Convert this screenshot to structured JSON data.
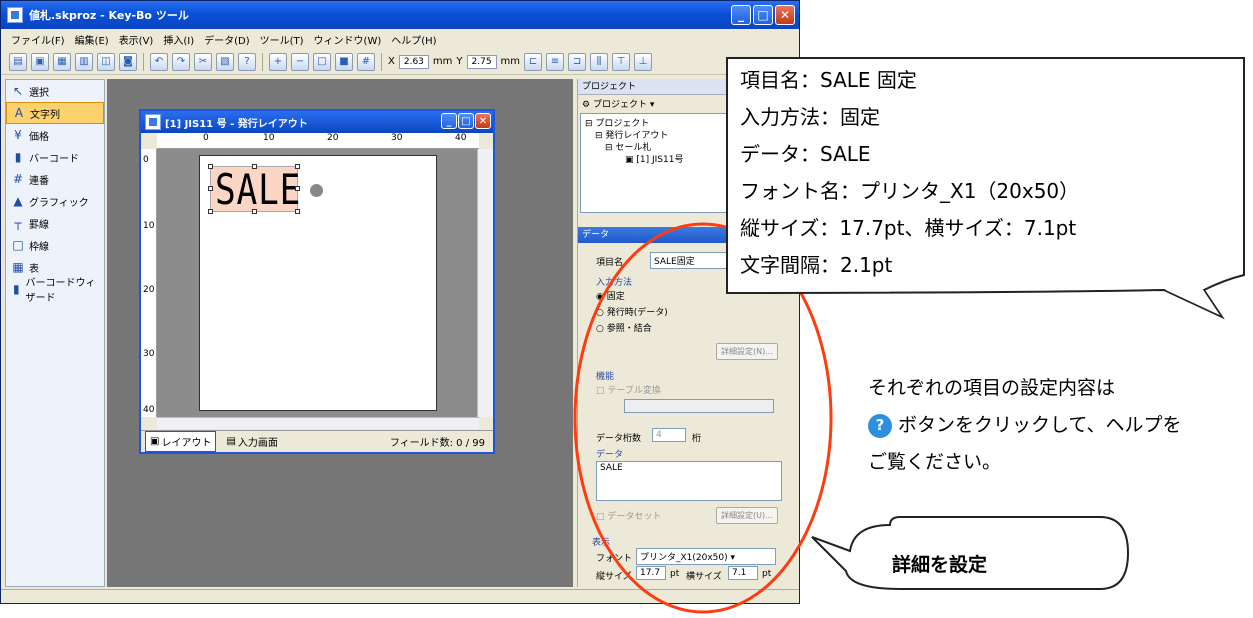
{
  "window": {
    "title": "値札.skproz - Key-Bo ツール"
  },
  "menu": [
    "ファイル(F)",
    "編集(E)",
    "表示(V)",
    "挿入(I)",
    "データ(D)",
    "ツール(T)",
    "ウィンドウ(W)",
    "ヘルプ(H)"
  ],
  "toolbar": {
    "x_label": "X",
    "x_value": "2.63",
    "x_unit": "mm",
    "y_label": "Y",
    "y_value": "2.75",
    "y_unit": "mm"
  },
  "tools": [
    {
      "label": "選択",
      "icon": "select-arrow-icon"
    },
    {
      "label": "文字列",
      "icon": "text-icon"
    },
    {
      "label": "価格",
      "icon": "price-icon"
    },
    {
      "label": "バーコード",
      "icon": "barcode-icon"
    },
    {
      "label": "連番",
      "icon": "serial-icon"
    },
    {
      "label": "グラフィック",
      "icon": "graphic-icon"
    },
    {
      "label": "罫線",
      "icon": "line-icon"
    },
    {
      "label": "枠線",
      "icon": "frame-icon"
    },
    {
      "label": "表",
      "icon": "table-icon"
    },
    {
      "label": "バーコードウィザード",
      "icon": "barcode-wizard-icon"
    }
  ],
  "document": {
    "title": "[1] JIS11 号 - 発行レイアウト",
    "ruler_top": [
      "0",
      "10",
      "20",
      "30",
      "40"
    ],
    "ruler_left": [
      "0",
      "10",
      "20",
      "30",
      "40"
    ],
    "object_text": "SALE",
    "tab_layout": "レイアウト",
    "tab_input": "入力画面",
    "field_count": "フィールド数: 0 / 99"
  },
  "project": {
    "header": "プロジェクト",
    "dropdown": "プロジェクト",
    "tree": [
      "プロジェクト",
      "発行レイアウト",
      "セール札",
      "[1] JIS11号"
    ],
    "layout_tab_partial": "レイ"
  },
  "data_panel": {
    "header": "データ",
    "item_name_label": "項目名",
    "item_name_value": "SALE固定",
    "input_method_label": "入力方法",
    "radio_fixed": "固定",
    "radio_issue": "発行時(データ)",
    "radio_ref": "参照・結合",
    "detail_btn": "詳細設定(N)...",
    "function_label": "機能",
    "table_convert": "テーブル変換",
    "digits_label": "データ桁数",
    "digits_value": "4",
    "digits_unit": "桁",
    "data_label": "データ",
    "data_value": "SALE",
    "dataset_label": "データセット",
    "detail_btn2": "詳細設定(U)...",
    "display_label": "表示",
    "font_label": "フォント",
    "font_value": "プリンタ_X1(20x50)",
    "vsize_label": "縦サイズ",
    "vsize_value": "17.7",
    "pt1": "pt",
    "hsize_label": "横サイズ",
    "hsize_value": "7.1",
    "pt2": "pt"
  },
  "callout": {
    "lines": [
      "項目名：SALE 固定",
      "入力方法：固定",
      "データ：SALE",
      "フォント名：プリンタ_X1（20x50）",
      "縦サイズ：17.7pt、横サイズ：7.1pt",
      "文字間隔：2.1pt"
    ]
  },
  "note": {
    "line1": "それぞれの項目の設定内容は",
    "line2": "ボタンをクリックして、ヘルプを",
    "line3": "ご覧ください。"
  },
  "bubble": {
    "text": "詳細を設定"
  },
  "colors": {
    "title_blue": "#0b45c0",
    "highlight_red": "#ff3b10",
    "active_tool": "#fbd26d"
  }
}
